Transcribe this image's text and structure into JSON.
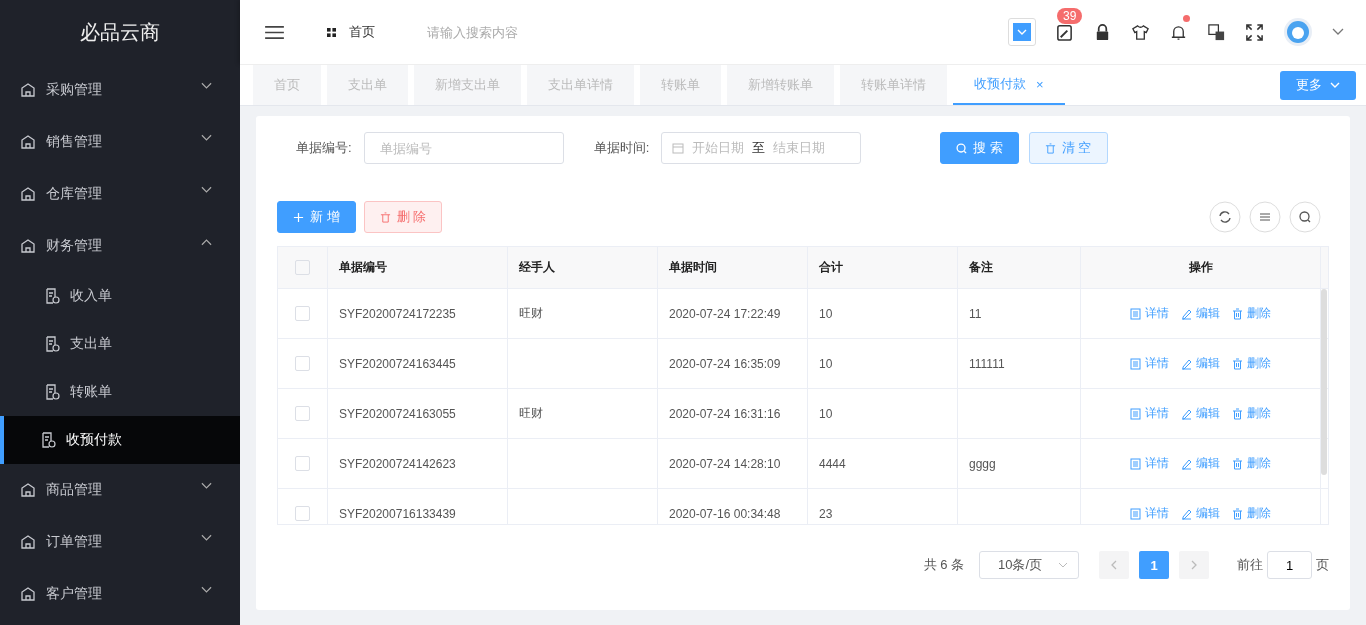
{
  "logo": "必品云商",
  "sidebar": {
    "items": [
      {
        "label": "采购管理",
        "expanded": false
      },
      {
        "label": "销售管理",
        "expanded": false
      },
      {
        "label": "仓库管理",
        "expanded": false
      },
      {
        "label": "财务管理",
        "expanded": true,
        "children": [
          {
            "label": "收入单",
            "selected": false
          },
          {
            "label": "支出单",
            "selected": false
          },
          {
            "label": "转账单",
            "selected": false
          },
          {
            "label": "收预付款",
            "selected": true
          }
        ]
      },
      {
        "label": "商品管理",
        "expanded": false
      },
      {
        "label": "订单管理",
        "expanded": false
      },
      {
        "label": "客户管理",
        "expanded": false
      }
    ]
  },
  "header": {
    "breadcrumb": "首页",
    "search": {
      "placeholder": "请输入搜索内容"
    },
    "badge": "39"
  },
  "tabs": [
    {
      "label": "首页",
      "selected": false
    },
    {
      "label": "支出单",
      "selected": false
    },
    {
      "label": "新增支出单",
      "selected": false
    },
    {
      "label": "支出单详情",
      "selected": false
    },
    {
      "label": "转账单",
      "selected": false
    },
    {
      "label": "新增转账单",
      "selected": false
    },
    {
      "label": "转账单详情",
      "selected": false
    },
    {
      "label": "收预付款",
      "selected": true,
      "close": "×"
    }
  ],
  "more_button": "更多",
  "filters": {
    "number_label": "单据编号:",
    "number_placeholder": "单据编号",
    "date_label": "单据时间:",
    "start_placeholder": "开始日期",
    "separator": "至",
    "end_placeholder": "结束日期",
    "search_button": "搜 索",
    "clear_button": "清 空"
  },
  "toolbar": {
    "add_button": "新 增",
    "delete_button": "删 除"
  },
  "table": {
    "select_all_checked": false,
    "columns": [
      "单据编号",
      "经手人",
      "单据时间",
      "合计",
      "备注",
      "操作"
    ],
    "rows": [
      {
        "checked": false,
        "cells": [
          "SYF20200724172235",
          "旺财",
          "2020-07-24 17:22:49",
          "10",
          "11"
        ],
        "actions": [
          {
            "kind": "detail",
            "label": "详情"
          },
          {
            "kind": "edit",
            "label": "编辑"
          },
          {
            "kind": "delete",
            "label": "删除"
          }
        ]
      },
      {
        "checked": false,
        "cells": [
          "SYF20200724163445",
          "",
          "2020-07-24 16:35:09",
          "10",
          "111111"
        ],
        "actions": [
          {
            "kind": "detail",
            "label": "详情"
          },
          {
            "kind": "edit",
            "label": "编辑"
          },
          {
            "kind": "delete",
            "label": "删除"
          }
        ]
      },
      {
        "checked": false,
        "cells": [
          "SYF20200724163055",
          "旺财",
          "2020-07-24 16:31:16",
          "10",
          ""
        ],
        "actions": [
          {
            "kind": "detail",
            "label": "详情"
          },
          {
            "kind": "edit",
            "label": "编辑"
          },
          {
            "kind": "delete",
            "label": "删除"
          }
        ]
      },
      {
        "checked": false,
        "cells": [
          "SYF20200724142623",
          "",
          "2020-07-24 14:28:10",
          "4444",
          "gggg"
        ],
        "actions": [
          {
            "kind": "detail",
            "label": "详情"
          },
          {
            "kind": "edit",
            "label": "编辑"
          },
          {
            "kind": "delete",
            "label": "删除"
          }
        ]
      },
      {
        "checked": false,
        "cells": [
          "SYF20200716133439",
          "",
          "2020-07-16 00:34:48",
          "23",
          ""
        ],
        "actions": [
          {
            "kind": "detail",
            "label": "详情"
          },
          {
            "kind": "edit",
            "label": "编辑"
          },
          {
            "kind": "delete",
            "label": "删除"
          }
        ]
      }
    ]
  },
  "pagination": {
    "total": "共 6 条",
    "page_size": "10条/页",
    "pages": [
      {
        "label": "1",
        "selected": true
      }
    ],
    "goto_label": "前往",
    "goto_value": "1",
    "page_suffix": "页"
  }
}
